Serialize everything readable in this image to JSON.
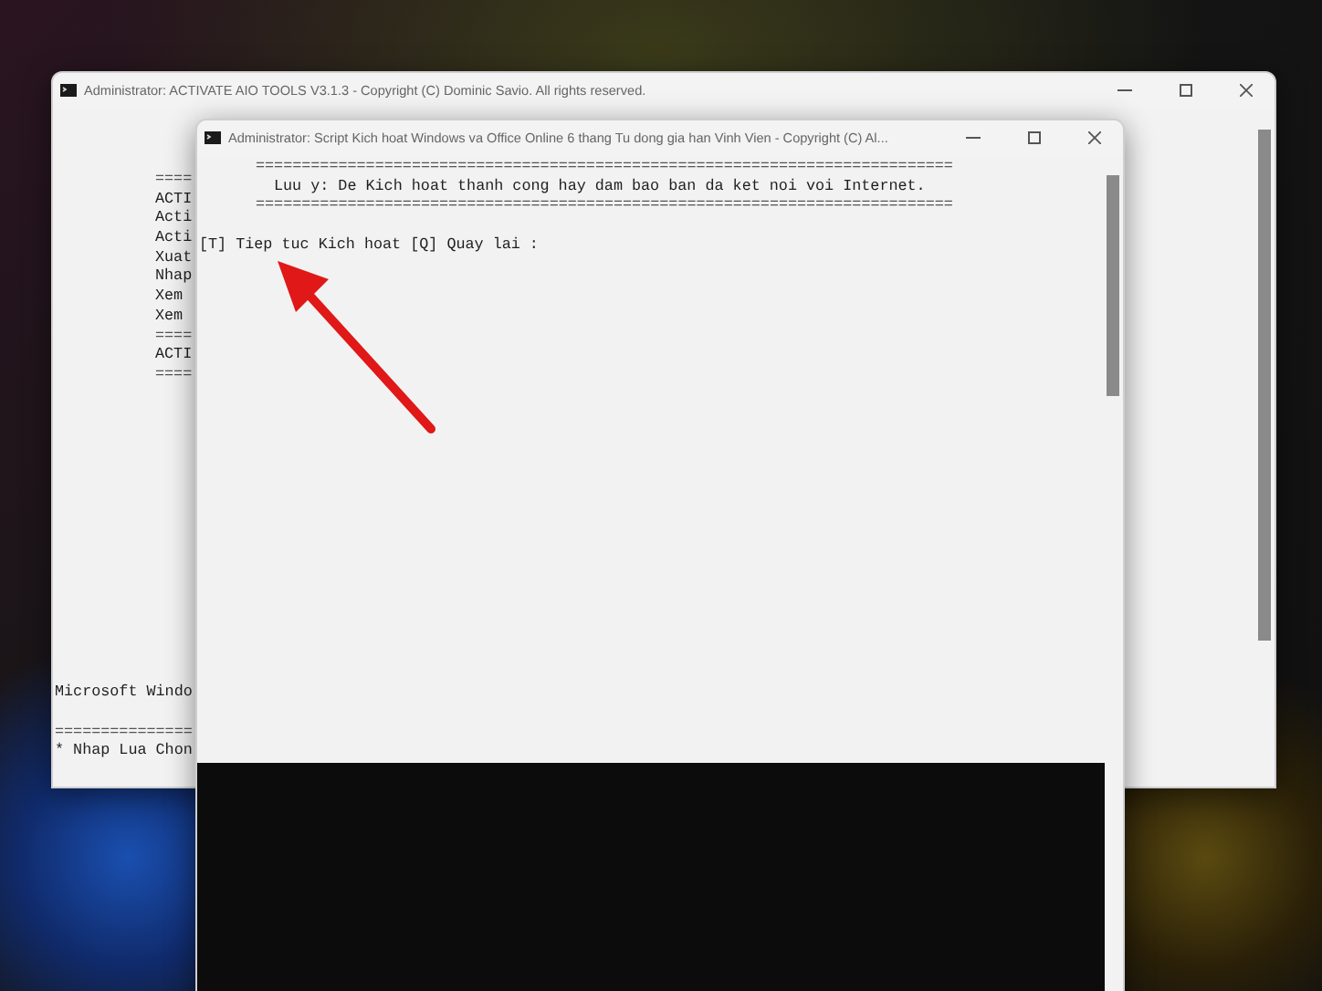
{
  "back_window": {
    "title": "Administrator:  ACTIVATE AIO TOOLS V3.1.3 - Copyright (C) Dominic Savio. All rights reserved.",
    "menu_lines": [
      {
        "kind": "rule",
        "text": "===="
      },
      {
        "kind": "text",
        "text": "ACTI"
      },
      {
        "kind": "text",
        "text": "Acti"
      },
      {
        "kind": "text",
        "text": "Acti"
      },
      {
        "kind": "text",
        "text": "Xuat"
      },
      {
        "kind": "text",
        "text": "Nhap"
      },
      {
        "kind": "text",
        "text": "Xem"
      },
      {
        "kind": "text",
        "text": "Xem"
      },
      {
        "kind": "rule",
        "text": "===="
      },
      {
        "kind": "text",
        "text": "ACTI"
      },
      {
        "kind": "rule",
        "text": "===="
      }
    ],
    "footer_lines": [
      {
        "kind": "text",
        "text": "Microsoft Windo"
      },
      {
        "kind": "blank"
      },
      {
        "kind": "rule",
        "text": "==============="
      },
      {
        "kind": "text",
        "text": "* Nhap Lua Chon"
      }
    ]
  },
  "front_window": {
    "title": "Administrator:  Script Kich hoat Windows va Office Online 6 thang Tu dong gia han Vinh Vien - Copyright (C) Al...",
    "lines": [
      {
        "kind": "rule",
        "text": "============================================================================"
      },
      {
        "kind": "notice",
        "text": "Luu y: De Kich hoat thanh cong hay dam bao ban da ket noi voi Internet."
      },
      {
        "kind": "rule",
        "text": "============================================================================"
      },
      {
        "kind": "blank"
      },
      {
        "kind": "prompt",
        "text": "[T] Tiep tuc Kich hoat [Q] Quay lai :"
      }
    ]
  }
}
